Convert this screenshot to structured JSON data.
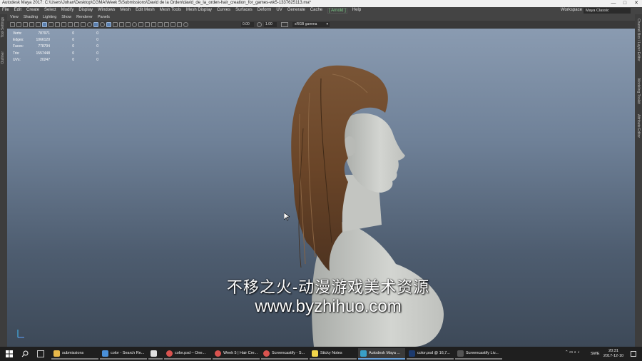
{
  "window": {
    "title": "Autodesk Maya 2017: C:\\Users\\Johan\\Desktop\\CGMA\\Week 5\\Submissions\\David de la Orden\\david_de_la_orden-hair_creation_for_games-wk5-1337625113.ma*",
    "controls": [
      "—",
      "□",
      "✕"
    ]
  },
  "menubar": {
    "items": [
      "File",
      "Edit",
      "Create",
      "Select",
      "Modify",
      "Display",
      "Windows",
      "Mesh",
      "Edit Mesh",
      "Mesh Tools",
      "Mesh Display",
      "Curves",
      "Surfaces",
      "Deform",
      "UV",
      "Generate",
      "Cache"
    ],
    "highlighted": "[ Arnold ]",
    "help": "Help",
    "workspace_label": "Workspace :",
    "workspace_value": "Maya Classic"
  },
  "left_strip": {
    "tool_settings": "Tool Settings",
    "outliner": "Outliner"
  },
  "right_strip": {
    "channel_box": "Channel Box / Layer Editor",
    "modeling_toolkit": "Modeling Toolkit",
    "attribute_editor": "Attribute Editor"
  },
  "panel_menu": {
    "items": [
      "View",
      "Shading",
      "Lighting",
      "Show",
      "Renderer",
      "Panels"
    ]
  },
  "toolbar": {
    "value_a": "0.00",
    "value_b": "1.00",
    "color_space": "sRGB gamma"
  },
  "hud": {
    "rows": [
      {
        "label": "Verts:",
        "v1": "787971",
        "v2": "0",
        "v3": "0"
      },
      {
        "label": "Edges:",
        "v1": "1066120",
        "v2": "0",
        "v3": "0"
      },
      {
        "label": "Faces:",
        "v1": "778794",
        "v2": "0",
        "v3": "0"
      },
      {
        "label": "Tris:",
        "v1": "1557448",
        "v2": "0",
        "v3": "0"
      },
      {
        "label": "UVs:",
        "v1": "20247",
        "v2": "0",
        "v3": "0"
      }
    ]
  },
  "watermark": {
    "line1": "不移之火-动漫游戏美术资源",
    "line2": "www.byzhihuo.com"
  },
  "taskbar": {
    "apps": [
      {
        "label": "submissions",
        "color": "#e8b84a",
        "state": "open"
      },
      {
        "label": "color - Search Re...",
        "color": "#4a90d9",
        "state": "open"
      },
      {
        "label": "",
        "color": "#e0e0e0",
        "state": "open"
      },
      {
        "label": "color.psd – One...",
        "color": "#d9534f",
        "state": "open"
      },
      {
        "label": "Week 5 | Hair Cre...",
        "color": "#d9534f",
        "state": "open"
      },
      {
        "label": "Screencastify - S...",
        "color": "#d9534f",
        "state": "open"
      },
      {
        "label": "Sticky Notes",
        "color": "#f2d64b",
        "state": "open"
      },
      {
        "label": "Autodesk Maya ...",
        "color": "#39a0c8",
        "state": "active"
      },
      {
        "label": "color.psd @ 16,7...",
        "color": "#1c3a6e",
        "state": "open"
      },
      {
        "label": "Screencastify Liv...",
        "color": "#555555",
        "state": "open"
      }
    ],
    "language": "SWE",
    "time": "20:31",
    "date": "2017-12-10"
  }
}
